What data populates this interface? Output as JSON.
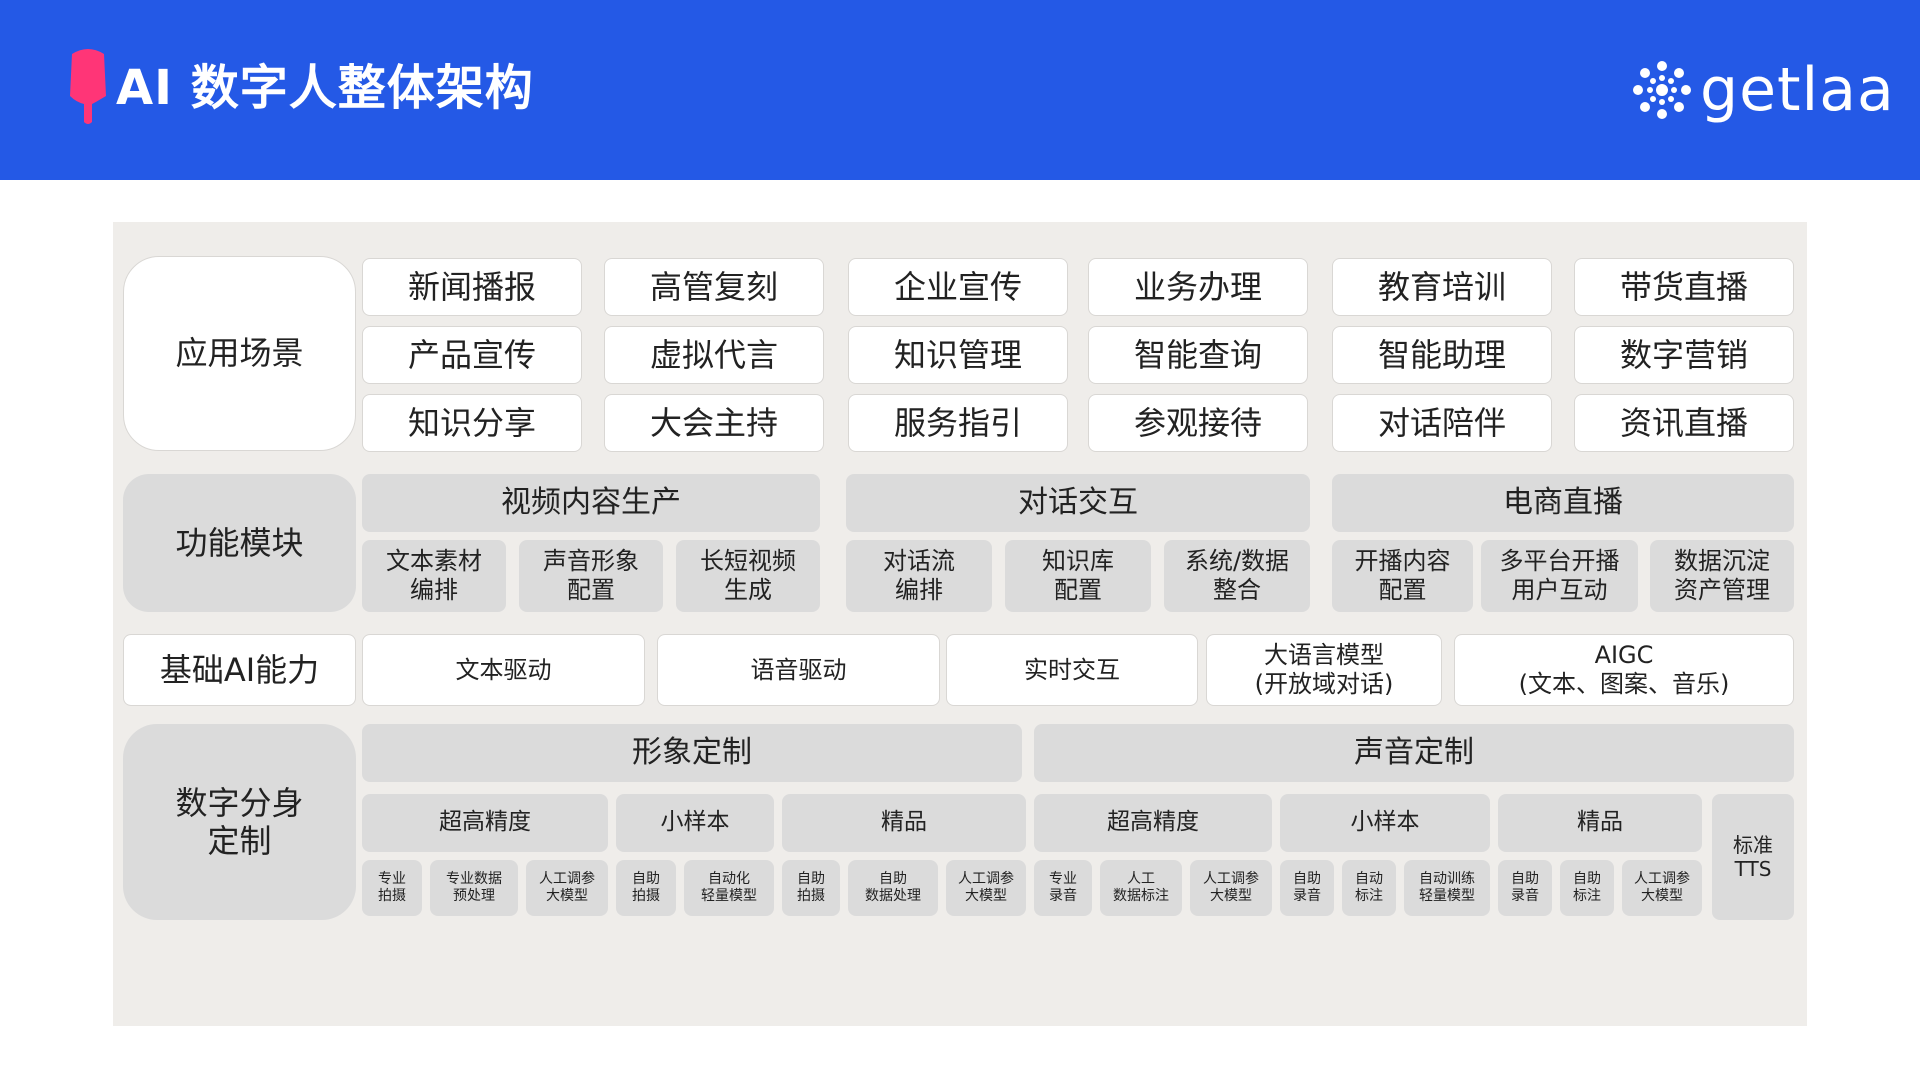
{
  "header": {
    "title": "AI 数字人整体架构",
    "brand": "getlaa",
    "colors": {
      "bar": "#2459e6",
      "logo_mark": "#ff3577",
      "panel": "#efedea",
      "gray_box": "#dbdbdb"
    }
  },
  "rows": {
    "scenes": {
      "label": "应用场景",
      "items": [
        "新闻播报",
        "高管复刻",
        "企业宣传",
        "业务办理",
        "教育培训",
        "带货直播",
        "产品宣传",
        "虚拟代言",
        "知识管理",
        "智能查询",
        "智能助理",
        "数字营销",
        "知识分享",
        "大会主持",
        "服务指引",
        "参观接待",
        "对话陪伴",
        "资讯直播"
      ]
    },
    "modules": {
      "label": "功能模块",
      "groups": [
        {
          "title": "视频内容生产",
          "items": [
            "文本素材\n编排",
            "声音形象\n配置",
            "长短视频\n生成"
          ]
        },
        {
          "title": "对话交互",
          "items": [
            "对话流\n编排",
            "知识库\n配置",
            "系统/数据\n整合"
          ]
        },
        {
          "title": "电商直播",
          "items": [
            "开播内容\n配置",
            "多平台开播\n用户互动",
            "数据沉淀\n资产管理"
          ]
        }
      ]
    },
    "ai": {
      "label": "基础AI能力",
      "items": [
        "文本驱动",
        "语音驱动",
        "实时交互",
        "大语言模型\n(开放域对话)",
        "AIGC\n(文本、图案、音乐)"
      ]
    },
    "custom": {
      "label": "数字分身\n定制",
      "image": {
        "title": "形象定制",
        "tiers": [
          {
            "name": "超高精度",
            "items": [
              "专业\n拍摄",
              "专业数据\n预处理",
              "人工调参\n大模型"
            ]
          },
          {
            "name": "小样本",
            "items": [
              "自助\n拍摄",
              "自动化\n轻量模型"
            ]
          },
          {
            "name": "精品",
            "items": [
              "自助\n拍摄",
              "自助\n数据处理",
              "人工调参\n大模型"
            ]
          }
        ]
      },
      "voice": {
        "title": "声音定制",
        "tiers": [
          {
            "name": "超高精度",
            "items": [
              "专业\n录音",
              "人工\n数据标注",
              "人工调参\n大模型"
            ]
          },
          {
            "name": "小样本",
            "items": [
              "自助\n录音",
              "自动\n标注",
              "自动训练\n轻量模型"
            ]
          },
          {
            "name": "精品",
            "items": [
              "自助\n录音",
              "自助\n标注",
              "人工调参\n大模型"
            ]
          }
        ],
        "tts": "标准\nTTS"
      }
    }
  }
}
